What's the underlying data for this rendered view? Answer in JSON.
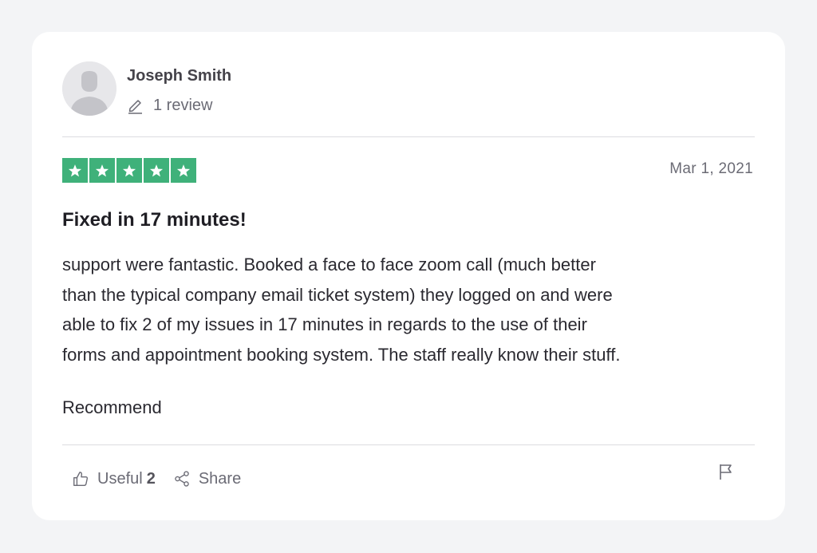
{
  "reviewer": {
    "name": "Joseph Smith",
    "review_count": "1 review"
  },
  "rating": {
    "stars": 5,
    "max": 5,
    "color": "#3fb17a"
  },
  "review": {
    "date": "Mar 1, 2021",
    "title": "Fixed in 17 minutes!",
    "body_lines": [
      "support were fantastic. Booked a face to face zoom call (much better",
      "than the typical company email ticket system) they logged on and were",
      "able to fix 2 of my issues in 17 minutes in regards to the use of their",
      "forms and appointment booking system. The staff really know their stuff."
    ],
    "closing": "Recommend"
  },
  "actions": {
    "useful_label": "Useful",
    "useful_count": "2",
    "share_label": "Share"
  },
  "icons": {
    "avatar": "user-silhouette-icon",
    "review_count": "pencil-icon",
    "star": "star-icon",
    "useful": "thumbs-up-icon",
    "share": "share-icon",
    "report": "flag-icon"
  }
}
